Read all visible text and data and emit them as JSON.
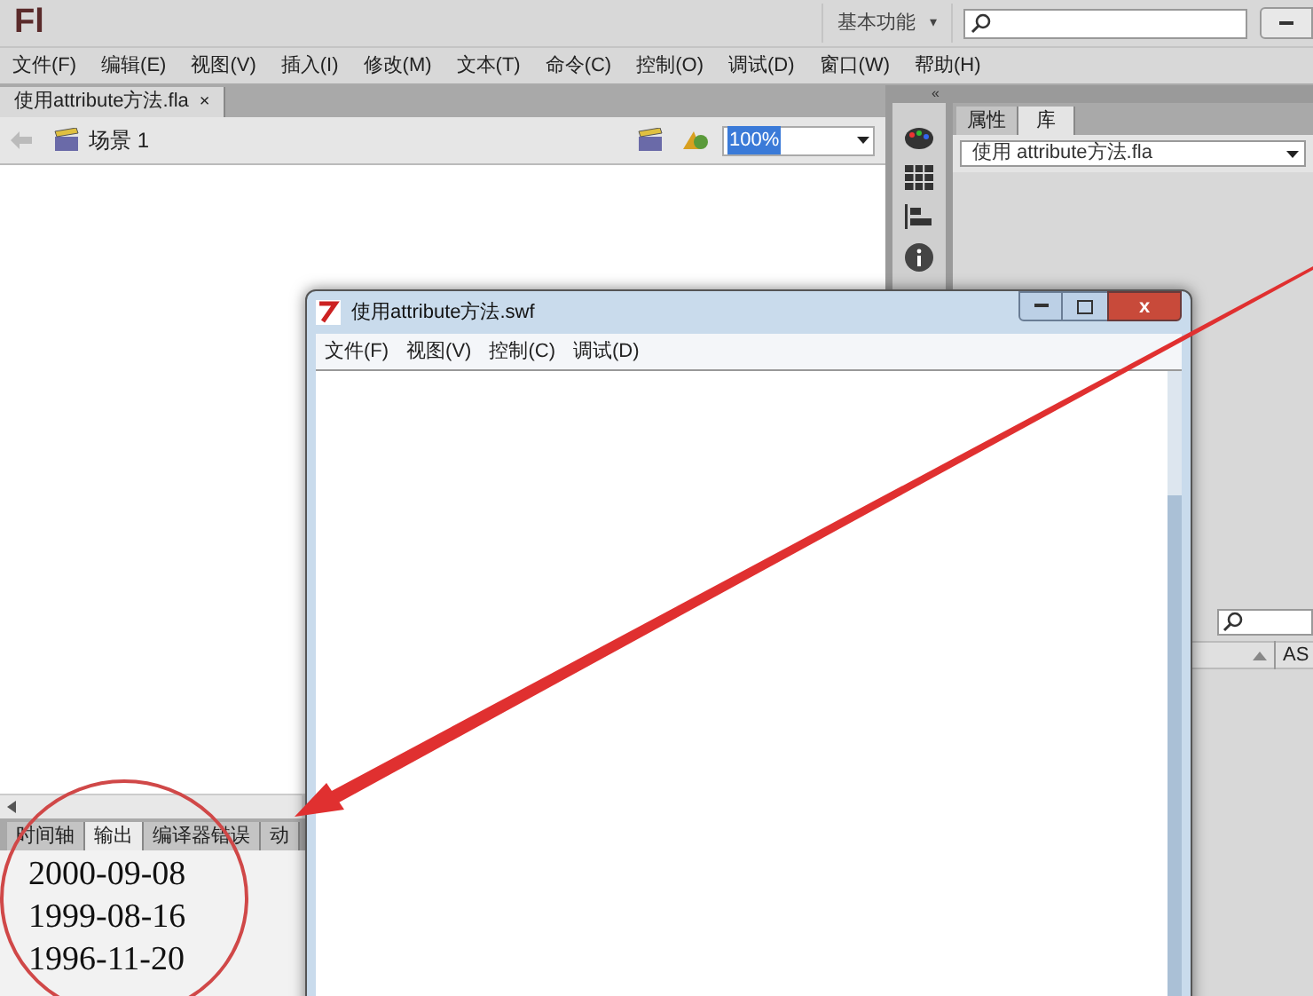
{
  "app": {
    "logo": "Fl",
    "workspace": "基本功能",
    "workspace_caret": "▾"
  },
  "menu": [
    "文件(F)",
    "编辑(E)",
    "视图(V)",
    "插入(I)",
    "修改(M)",
    "文本(T)",
    "命令(C)",
    "控制(O)",
    "调试(D)",
    "窗口(W)",
    "帮助(H)"
  ],
  "document_tabs": [
    {
      "label": "使用attribute方法.fla",
      "close": "×",
      "selected": true
    }
  ],
  "scene": {
    "label": "场景 1",
    "zoom": "100%"
  },
  "output_panel": {
    "tabs": [
      {
        "label": "时间轴",
        "selected": false
      },
      {
        "label": "输出",
        "selected": true
      },
      {
        "label": "编译器错误",
        "selected": false
      },
      {
        "label": "动",
        "selected": false
      }
    ],
    "lines": [
      "2000-09-08",
      "1999-08-16",
      "1996-11-20"
    ]
  },
  "right_panel": {
    "collapse": "«",
    "tabs": [
      {
        "label": "属性",
        "selected": false
      },
      {
        "label": "库",
        "selected": true
      }
    ],
    "library": "使用 attribute方法.fla",
    "column": "AS"
  },
  "swf_window": {
    "title": "使用attribute方法.swf",
    "close": "x",
    "menu": [
      "文件(F)",
      "视图(V)",
      "控制(C)",
      "调试(D)"
    ]
  }
}
